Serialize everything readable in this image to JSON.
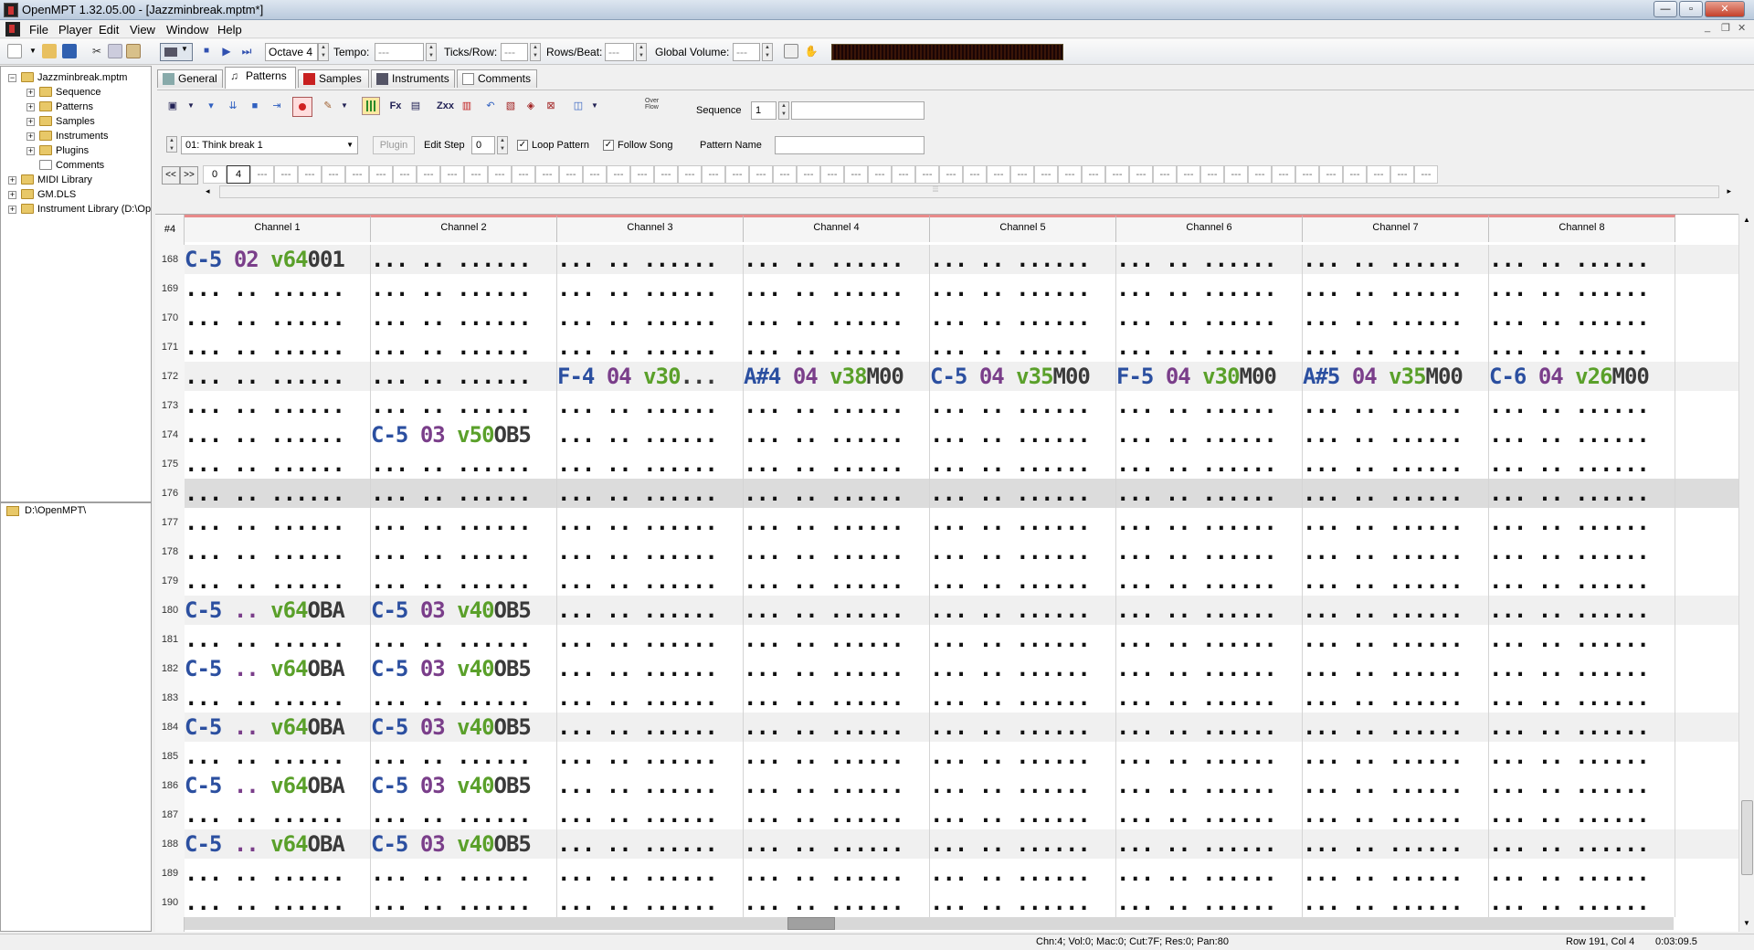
{
  "window": {
    "title": "OpenMPT 1.32.05.00 - [Jazzminbreak.mptm*]"
  },
  "menu": {
    "items": [
      "File",
      "Player",
      "Edit",
      "View",
      "Window",
      "Help"
    ]
  },
  "toolbar": {
    "octave": "Octave 4",
    "tempo_label": "Tempo:",
    "tempo": "---",
    "ticks_label": "Ticks/Row:",
    "ticks": "---",
    "rows_label": "Rows/Beat:",
    "rows": "---",
    "gvol_label": "Global Volume:",
    "gvol": "---"
  },
  "tree": {
    "items": [
      {
        "label": "Jazzminbreak.mptm",
        "level": 0,
        "expander": "−"
      },
      {
        "label": "Sequence",
        "level": 1,
        "expander": "+"
      },
      {
        "label": "Patterns",
        "level": 1,
        "expander": "+"
      },
      {
        "label": "Samples",
        "level": 1,
        "expander": "+"
      },
      {
        "label": "Instruments",
        "level": 1,
        "expander": "+"
      },
      {
        "label": "Plugins",
        "level": 1,
        "expander": "+"
      },
      {
        "label": "Comments",
        "level": 1,
        "expander": ""
      },
      {
        "label": "MIDI Library",
        "level": 0,
        "expander": "+"
      },
      {
        "label": "GM.DLS",
        "level": 0,
        "expander": "+"
      },
      {
        "label": "Instrument Library (D:\\Op",
        "level": 0,
        "expander": "+"
      }
    ]
  },
  "filebrowser": {
    "path": "D:\\OpenMPT\\"
  },
  "tabs": [
    "General",
    "Patterns",
    "Samples",
    "Instruments",
    "Comments"
  ],
  "patterns": {
    "overflow": "Over\nFlow",
    "sequence_label": "Sequence",
    "sequence": "1",
    "pattern_select": "01: Think break 1",
    "plugin_label": "Plugin",
    "edit_step_label": "Edit Step",
    "edit_step": "0",
    "loop_label": "Loop Pattern",
    "follow_label": "Follow Song",
    "pattern_name_label": "Pattern Name",
    "pattern_name": ""
  },
  "orderlist": {
    "prev": "<<",
    "next": ">>",
    "orders": [
      "0",
      "4"
    ],
    "empty": "---"
  },
  "grid": {
    "pattern_label": "#4",
    "channels": [
      "Channel 1",
      "Channel 2",
      "Channel 3",
      "Channel 4",
      "Channel 5",
      "Channel 6",
      "Channel 7",
      "Channel 8"
    ],
    "rows": [
      {
        "n": "168",
        "c": [
          [
            "C-5",
            "02",
            "v64",
            "001"
          ],
          null,
          null,
          null,
          null,
          null,
          null,
          null
        ]
      },
      {
        "n": "169",
        "c": [
          null,
          null,
          null,
          null,
          null,
          null,
          null,
          null
        ]
      },
      {
        "n": "170",
        "c": [
          null,
          null,
          null,
          null,
          null,
          null,
          null,
          null
        ]
      },
      {
        "n": "171",
        "c": [
          null,
          null,
          null,
          null,
          null,
          null,
          null,
          null
        ]
      },
      {
        "n": "172",
        "c": [
          null,
          null,
          [
            "F-4",
            "04",
            "v30",
            "..."
          ],
          [
            "A#4",
            "04",
            "v38",
            "M00"
          ],
          [
            "C-5",
            "04",
            "v35",
            "M00"
          ],
          [
            "F-5",
            "04",
            "v30",
            "M00"
          ],
          [
            "A#5",
            "04",
            "v35",
            "M00"
          ],
          [
            "C-6",
            "04",
            "v26",
            "M00"
          ]
        ]
      },
      {
        "n": "173",
        "c": [
          null,
          null,
          null,
          null,
          null,
          null,
          null,
          null
        ]
      },
      {
        "n": "174",
        "c": [
          null,
          [
            "C-5",
            "03",
            "v50",
            "OB5"
          ],
          null,
          null,
          null,
          null,
          null,
          null
        ]
      },
      {
        "n": "175",
        "c": [
          null,
          null,
          null,
          null,
          null,
          null,
          null,
          null
        ]
      },
      {
        "n": "176",
        "c": [
          null,
          null,
          null,
          null,
          null,
          null,
          null,
          null
        ]
      },
      {
        "n": "177",
        "c": [
          null,
          null,
          null,
          null,
          null,
          null,
          null,
          null
        ]
      },
      {
        "n": "178",
        "c": [
          null,
          null,
          null,
          null,
          null,
          null,
          null,
          null
        ]
      },
      {
        "n": "179",
        "c": [
          null,
          null,
          null,
          null,
          null,
          null,
          null,
          null
        ]
      },
      {
        "n": "180",
        "c": [
          [
            "C-5",
            "..",
            "v64",
            "OBA"
          ],
          [
            "C-5",
            "03",
            "v40",
            "OB5"
          ],
          null,
          null,
          null,
          null,
          null,
          null
        ]
      },
      {
        "n": "181",
        "c": [
          null,
          null,
          null,
          null,
          null,
          null,
          null,
          null
        ]
      },
      {
        "n": "182",
        "c": [
          [
            "C-5",
            "..",
            "v64",
            "OBA"
          ],
          [
            "C-5",
            "03",
            "v40",
            "OB5"
          ],
          null,
          null,
          null,
          null,
          null,
          null
        ]
      },
      {
        "n": "183",
        "c": [
          null,
          null,
          null,
          null,
          null,
          null,
          null,
          null
        ]
      },
      {
        "n": "184",
        "c": [
          [
            "C-5",
            "..",
            "v64",
            "OBA"
          ],
          [
            "C-5",
            "03",
            "v40",
            "OB5"
          ],
          null,
          null,
          null,
          null,
          null,
          null
        ]
      },
      {
        "n": "185",
        "c": [
          null,
          null,
          null,
          null,
          null,
          null,
          null,
          null
        ]
      },
      {
        "n": "186",
        "c": [
          [
            "C-5",
            "..",
            "v64",
            "OBA"
          ],
          [
            "C-5",
            "03",
            "v40",
            "OB5"
          ],
          null,
          null,
          null,
          null,
          null,
          null
        ]
      },
      {
        "n": "187",
        "c": [
          null,
          null,
          null,
          null,
          null,
          null,
          null,
          null
        ]
      },
      {
        "n": "188",
        "c": [
          [
            "C-5",
            "..",
            "v64",
            "OBA"
          ],
          [
            "C-5",
            "03",
            "v40",
            "OB5"
          ],
          null,
          null,
          null,
          null,
          null,
          null
        ]
      },
      {
        "n": "189",
        "c": [
          null,
          null,
          null,
          null,
          null,
          null,
          null,
          null
        ]
      },
      {
        "n": "190",
        "c": [
          null,
          null,
          null,
          null,
          null,
          null,
          null,
          null
        ]
      }
    ]
  },
  "status": {
    "info": "Chn:4; Vol:0; Mac:0; Cut:7F; Res:0; Pan:80",
    "position": "Row 191, Col 4",
    "time": "0:03:09.5"
  }
}
